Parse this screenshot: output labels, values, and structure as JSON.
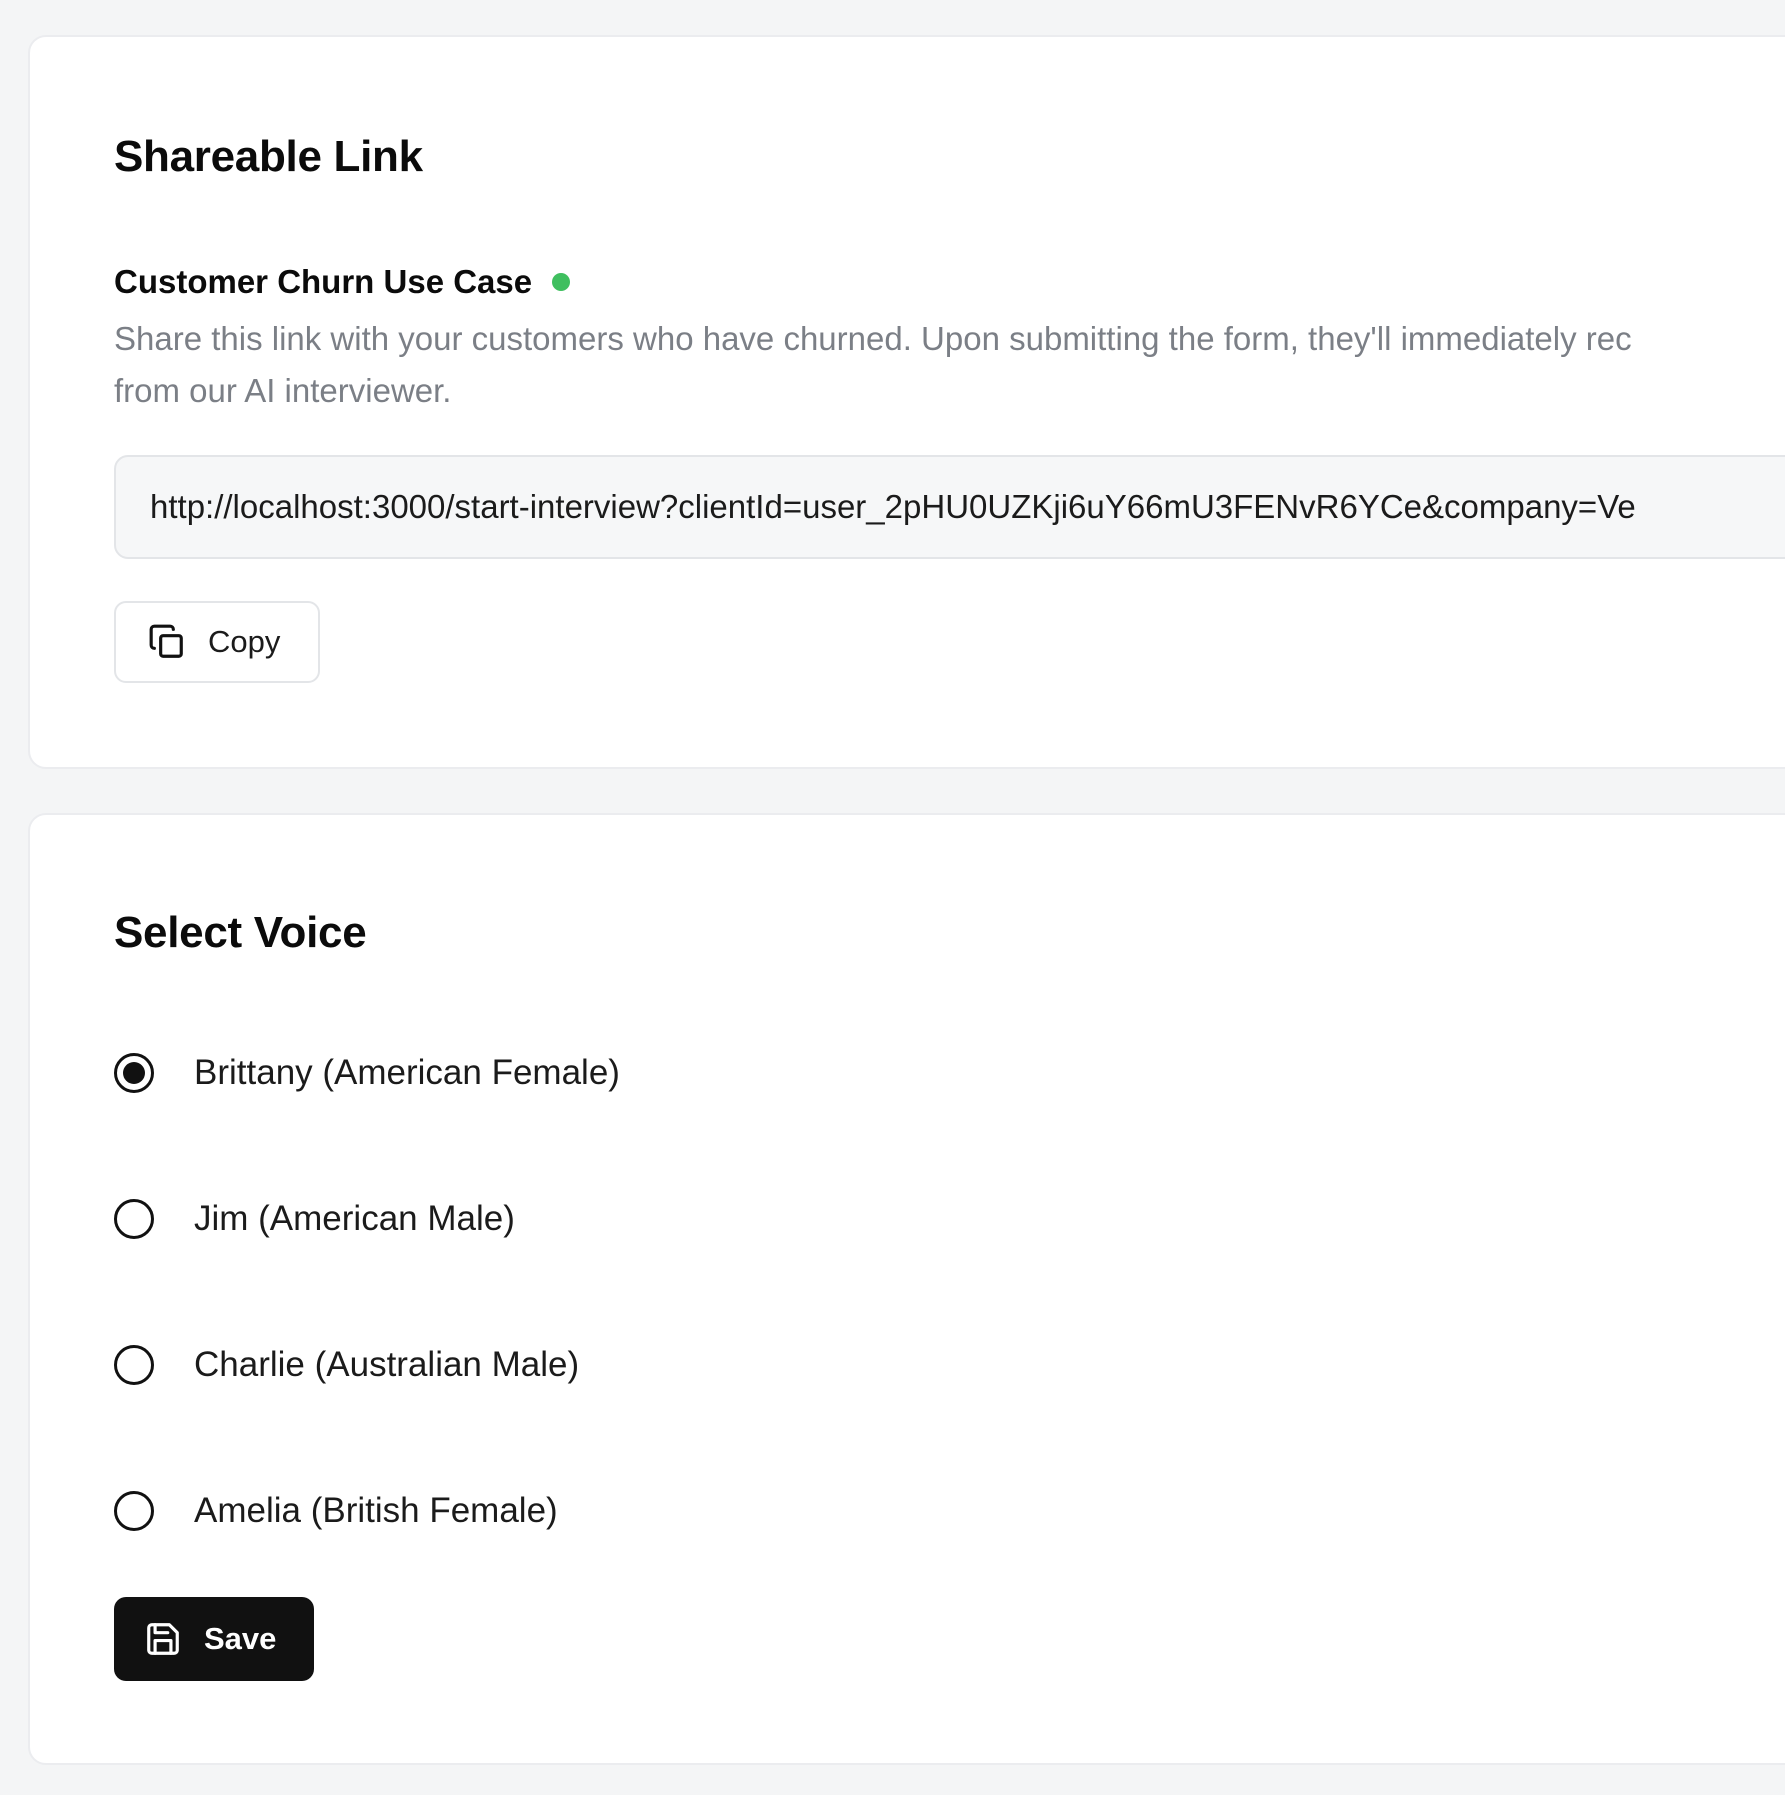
{
  "shareable_link": {
    "title": "Shareable Link",
    "use_case_title": "Customer Churn Use Case",
    "status_color": "#3fbf5f",
    "description_line1": "Share this link with your customers who have churned. Upon submitting the form, they'll immediately rec",
    "description_line2": "from our AI interviewer.",
    "url": "http://localhost:3000/start-interview?clientId=user_2pHU0UZKji6uY66mU3FENvR6YCe&company=Ve",
    "copy_label": "Copy",
    "copy_icon": "copy-icon"
  },
  "voice": {
    "title": "Select Voice",
    "options": [
      {
        "label": "Brittany (American Female)",
        "selected": true
      },
      {
        "label": "Jim (American Male)",
        "selected": false
      },
      {
        "label": "Charlie (Australian Male)",
        "selected": false
      },
      {
        "label": "Amelia (British Female)",
        "selected": false
      }
    ],
    "save_label": "Save",
    "save_icon": "save-icon"
  }
}
